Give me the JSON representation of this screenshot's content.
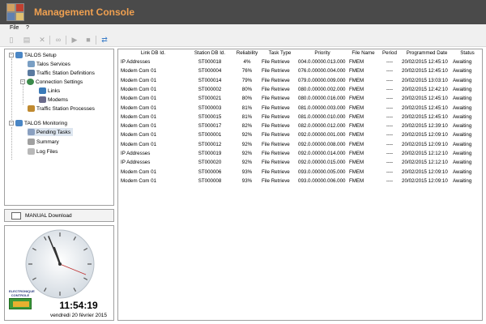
{
  "window": {
    "title": "Management Console",
    "logo_icon": "app-logo-icon"
  },
  "menu": [
    {
      "label": "File"
    },
    {
      "label": "?"
    }
  ],
  "toolbar": {
    "buttons": [
      "new-icon",
      "edit-icon",
      "delete-icon",
      "link-icon",
      "play-icon",
      "stop-icon",
      "refresh-icon"
    ]
  },
  "tree": {
    "nodes": [
      {
        "label": "TALOS Setup",
        "icon": "setup-icon",
        "expander": "−"
      },
      {
        "label": "Talos Services",
        "icon": "services-icon"
      },
      {
        "label": "Traffic Station Definitions",
        "icon": "station-icon"
      },
      {
        "label": "Connection Settings",
        "icon": "globe-icon",
        "expander": "−"
      },
      {
        "label": "Links",
        "icon": "links-icon"
      },
      {
        "label": "Modems",
        "icon": "modem-icon"
      },
      {
        "label": "Traffic Station Processes",
        "icon": "process-icon"
      },
      {
        "label": "TALOS Monitoring",
        "icon": "monitoring-icon",
        "expander": "−"
      },
      {
        "label": "Pending Tasks",
        "icon": "tasks-icon"
      },
      {
        "label": "Summary",
        "icon": "summary-icon"
      },
      {
        "label": "Log Files",
        "icon": "logfile-icon"
      }
    ]
  },
  "manual_download": {
    "label": "MANUAL Download"
  },
  "clock": {
    "time": "11:54:19",
    "date": "vendredi 20 février 2015",
    "company_logo_text": [
      "ELECTRONIQUE",
      "CONTROLE"
    ]
  },
  "table": {
    "columns": [
      "Link DB Id.",
      "Station DB Id.",
      "Reliability",
      "Task Type",
      "Priority",
      "File Name",
      "Period",
      "Programmed Date",
      "Status"
    ],
    "rows": [
      [
        "IP Addresses",
        "ST000018",
        "4%",
        "File Retrieve",
        "004.0.00000.013.000",
        "FMEM",
        "----",
        "20/02/2015 12:45:10",
        "Awaiting"
      ],
      [
        "Modem Com 01",
        "ST000004",
        "76%",
        "File Retrieve",
        "076.0.00000.004.000",
        "FMEM",
        "----",
        "20/02/2015 12:45:10",
        "Awaiting"
      ],
      [
        "Modem Com 01",
        "ST000014",
        "79%",
        "File Retrieve",
        "079.0.00000.009.000",
        "FMEM",
        "----",
        "20/02/2015 13:03:10",
        "Awaiting"
      ],
      [
        "Modem Com 01",
        "ST000002",
        "80%",
        "File Retrieve",
        "080.0.00000.002.000",
        "FMEM",
        "----",
        "20/02/2015 12:42:10",
        "Awaiting"
      ],
      [
        "Modem Com 01",
        "ST000021",
        "80%",
        "File Retrieve",
        "080.0.00000.016.000",
        "FMEM",
        "----",
        "20/02/2015 12:45:10",
        "Awaiting"
      ],
      [
        "Modem Com 01",
        "ST000003",
        "81%",
        "File Retrieve",
        "081.0.00000.003.000",
        "FMEM",
        "----",
        "20/02/2015 12:45:10",
        "Awaiting"
      ],
      [
        "Modem Com 01",
        "ST000015",
        "81%",
        "File Retrieve",
        "081.0.00000.010.000",
        "FMEM",
        "----",
        "20/02/2015 12:45:10",
        "Awaiting"
      ],
      [
        "Modem Com 01",
        "ST000017",
        "82%",
        "File Retrieve",
        "082.0.00000.012.000",
        "FMEM",
        "----",
        "20/02/2015 12:39:10",
        "Awaiting"
      ],
      [
        "Modem Com 01",
        "ST000001",
        "92%",
        "File Retrieve",
        "092.0.00000.001.000",
        "FMEM",
        "----",
        "20/02/2015 12:09:10",
        "Awaiting"
      ],
      [
        "Modem Com 01",
        "ST000012",
        "92%",
        "File Retrieve",
        "092.0.00000.008.000",
        "FMEM",
        "----",
        "20/02/2015 12:09:10",
        "Awaiting"
      ],
      [
        "IP Addresses",
        "ST000019",
        "92%",
        "File Retrieve",
        "092.0.00000.014.000",
        "FMEM",
        "----",
        "20/02/2015 12:12:10",
        "Awaiting"
      ],
      [
        "IP Addresses",
        "ST000020",
        "92%",
        "File Retrieve",
        "092.0.00000.015.000",
        "FMEM",
        "----",
        "20/02/2015 12:12:10",
        "Awaiting"
      ],
      [
        "Modem Com 01",
        "ST000006",
        "93%",
        "File Retrieve",
        "093.0.00000.005.000",
        "FMEM",
        "----",
        "20/02/2015 12:09:10",
        "Awaiting"
      ],
      [
        "Modem Com 01",
        "ST000008",
        "93%",
        "File Retrieve",
        "093.0.00000.006.000",
        "FMEM",
        "----",
        "20/02/2015 12:09:10",
        "Awaiting"
      ]
    ]
  },
  "colors": {
    "titlebar_bg": "#4a4a4a",
    "title_text": "#f0a050"
  }
}
